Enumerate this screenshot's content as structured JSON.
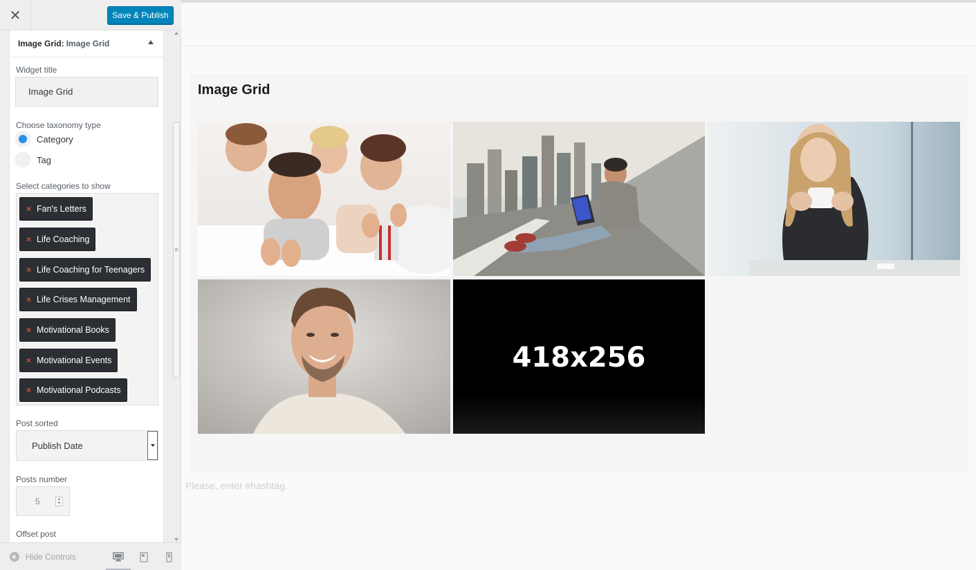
{
  "topbar": {
    "close_icon": "close-icon",
    "publish_label": "Save & Publish"
  },
  "widget": {
    "title_prefix": "Image Grid:",
    "title_name": "Image Grid",
    "toggle_icon": "arrow-up-icon"
  },
  "form": {
    "widget_title_label": "Widget title",
    "widget_title_value": "Image Grid",
    "taxonomy_label": "Choose taxonomy type",
    "taxonomy_options": [
      {
        "label": "Category",
        "checked": true
      },
      {
        "label": "Tag",
        "checked": false
      }
    ],
    "categories_label": "Select categories to show",
    "categories": [
      "Fan's Letters",
      "Life Coaching",
      "Life Coaching for Teenagers",
      "Life Crises Management",
      "Motivational Books",
      "Motivational Events",
      "Motivational Podcasts"
    ],
    "remove_glyph": "×",
    "post_sorted_label": "Post sorted",
    "post_sorted_value": "Publish Date",
    "posts_number_label": "Posts number",
    "posts_number_value": "5",
    "offset_label": "Offset post"
  },
  "footer": {
    "hide_controls_label": "Hide Controls",
    "devices": [
      "desktop-icon",
      "tablet-icon",
      "mobile-icon"
    ]
  },
  "preview": {
    "widget_title": "Image Grid",
    "images": [
      {
        "name": "family-photo",
        "description": "family"
      },
      {
        "name": "man-laptop-photo",
        "description": "city"
      },
      {
        "name": "woman-coffee-photo",
        "description": "woman"
      },
      {
        "name": "smiling-man-photo",
        "description": "man"
      },
      {
        "name": "placeholder-image",
        "placeholder_text": "418x256"
      }
    ],
    "hashtag_placeholder": "Please, enter #hashtag."
  },
  "colors": {
    "accent": "#0085ba",
    "tag_bg": "#2b2f33",
    "remove": "#d64e3c",
    "radio_checked": "#2b8fe8"
  }
}
